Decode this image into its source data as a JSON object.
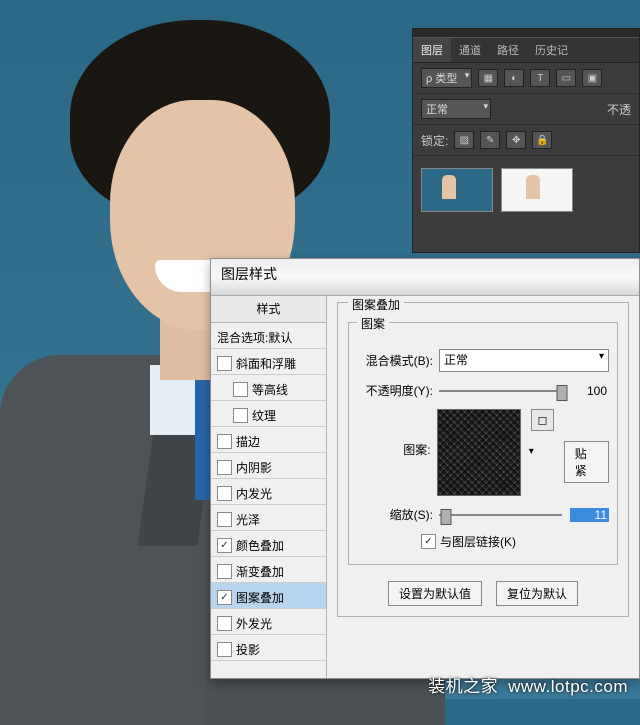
{
  "ps_panel": {
    "tabs": [
      "图层",
      "通道",
      "路径",
      "历史记"
    ],
    "type_label": "类型",
    "blend": "正常",
    "opacity_label": "不透",
    "lock_label": "锁定:"
  },
  "dialog": {
    "title": "图层样式",
    "styles_header": "样式",
    "blending_options": "混合选项:默认",
    "items": [
      {
        "label": "斜面和浮雕",
        "checked": false,
        "indent": 0
      },
      {
        "label": "等高线",
        "checked": false,
        "indent": 1
      },
      {
        "label": "纹理",
        "checked": false,
        "indent": 1
      },
      {
        "label": "描边",
        "checked": false,
        "indent": 0
      },
      {
        "label": "内阴影",
        "checked": false,
        "indent": 0
      },
      {
        "label": "内发光",
        "checked": false,
        "indent": 0
      },
      {
        "label": "光泽",
        "checked": false,
        "indent": 0
      },
      {
        "label": "颜色叠加",
        "checked": true,
        "indent": 0
      },
      {
        "label": "渐变叠加",
        "checked": false,
        "indent": 0
      },
      {
        "label": "图案叠加",
        "checked": true,
        "indent": 0,
        "selected": true
      },
      {
        "label": "外发光",
        "checked": false,
        "indent": 0
      },
      {
        "label": "投影",
        "checked": false,
        "indent": 0
      }
    ],
    "section_title": "图案叠加",
    "group_title": "图案",
    "blend_mode_label": "混合模式(B):",
    "blend_mode_value": "正常",
    "opacity_label": "不透明度(Y):",
    "opacity_value": "100",
    "pattern_label": "图案:",
    "snap_label": "贴紧",
    "scale_label": "缩放(S):",
    "scale_value": "11",
    "link_label": "与图层链接(K)",
    "link_checked": true,
    "default_btn": "设置为默认值",
    "reset_btn": "复位为默认"
  },
  "watermark": {
    "brand": "装机之家",
    "url": "www.lotpc.com"
  }
}
